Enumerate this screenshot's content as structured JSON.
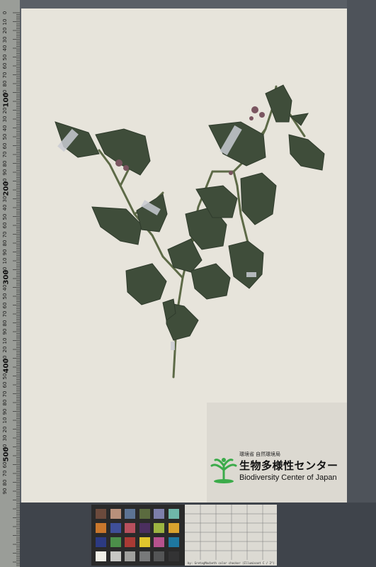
{
  "ruler": {
    "small_labels": [
      "0",
      "10",
      "20",
      "30",
      "40",
      "50",
      "60",
      "70",
      "80",
      "90",
      "10",
      "20",
      "30",
      "40",
      "50",
      "60",
      "70",
      "80",
      "90",
      "10",
      "20",
      "30",
      "40",
      "50",
      "60",
      "70",
      "80",
      "90",
      "10",
      "20",
      "30",
      "40",
      "50",
      "60",
      "70",
      "80",
      "90",
      "10",
      "20",
      "30",
      "40",
      "50",
      "60",
      "70",
      "80",
      "90",
      "10",
      "20",
      "30",
      "40",
      "50",
      "60",
      "70",
      "80",
      "90"
    ],
    "big_labels": [
      "100",
      "200",
      "300",
      "400",
      "500"
    ]
  },
  "label": {
    "org_small": "環境省 自然環境局",
    "org_big": "生物多様性センター",
    "org_en": "Biodiversity Center of Japan"
  },
  "color_checker": {
    "colors": [
      "#6b4a3c",
      "#b8907b",
      "#5c7393",
      "#5b6b3f",
      "#7d7fab",
      "#6fb6a9",
      "#c9772c",
      "#3f4f98",
      "#b7505d",
      "#4b2f5f",
      "#9cb441",
      "#d9a22e",
      "#2c3a82",
      "#4c8f4a",
      "#a93a34",
      "#e0c52d",
      "#b6528d",
      "#1e77a0",
      "#f0efe7",
      "#c7c7c4",
      "#a0a09d",
      "#78797a",
      "#545556",
      "#333334"
    ],
    "footer": "by: GretagMacbeth color checker (Illuminant C / 2°)"
  },
  "colors": {
    "leaf": "#3f4d3a",
    "leaf_dark": "#2f3b2c",
    "stem": "#5d6a47",
    "flower": "#7a5560",
    "tape": "#c9ccd2"
  }
}
